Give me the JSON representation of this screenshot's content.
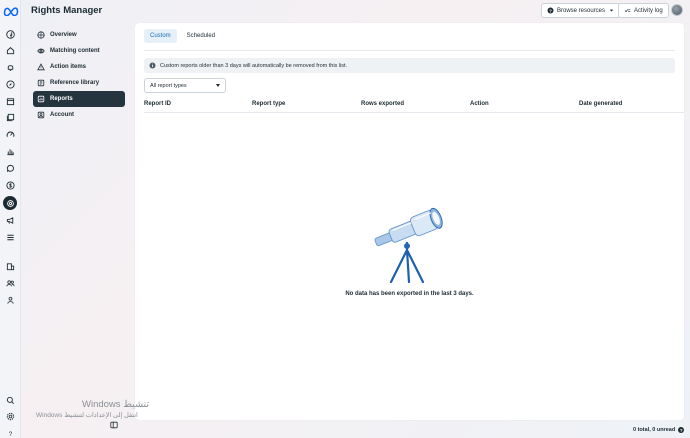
{
  "app": {
    "title": "Rights Manager"
  },
  "header": {
    "browse_resources": "Browse resources",
    "activity_log": "Activity log"
  },
  "nav": {
    "items": [
      {
        "label": "Overview",
        "icon": "grid-icon"
      },
      {
        "label": "Matching content",
        "icon": "eye-icon"
      },
      {
        "label": "Action items",
        "icon": "warning-icon"
      },
      {
        "label": "Reference library",
        "icon": "library-icon"
      },
      {
        "label": "Reports",
        "icon": "report-icon",
        "active": true
      },
      {
        "label": "Account",
        "icon": "account-icon"
      }
    ]
  },
  "main": {
    "tabs": [
      {
        "label": "Custom",
        "active": true
      },
      {
        "label": "Scheduled",
        "active": false
      }
    ],
    "notice": "Custom reports older than 3 days will automatically be removed from this list.",
    "filter_value": "All report types",
    "columns": [
      "Report ID",
      "Report type",
      "Rows exported",
      "Action",
      "Date generated"
    ],
    "empty_message": "No data has been exported in the last 3 days."
  },
  "footer": {
    "status": "0 total, 0 unread",
    "help": "?"
  },
  "watermark": {
    "title": "Windows تنشيط",
    "subtitle": "Windows انتقل إلى الإعدادات لتنشيط"
  },
  "colors": {
    "accent": "#1b6fb8",
    "active_nav": "#243540",
    "text": "#1c2b33"
  }
}
